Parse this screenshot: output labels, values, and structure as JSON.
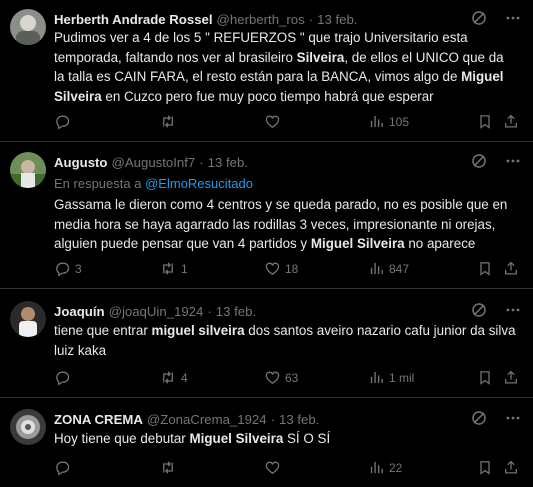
{
  "colors": {
    "background": "#000000",
    "text_primary": "#e7e9ea",
    "text_secondary": "#71767b",
    "link": "#1d9bf0",
    "divider": "#2f3336"
  },
  "icons": {
    "reply": "reply-icon",
    "repost": "repost-icon",
    "like": "heart-icon",
    "views": "views-icon",
    "bookmark": "bookmark-icon",
    "share": "share-icon",
    "grok": "grok-icon",
    "more": "more-icon"
  },
  "tweets": [
    {
      "name": "Herberth Andrade Rossel",
      "handle": "@herberth_ros",
      "date": "13 feb.",
      "reply_to_prefix": "",
      "reply_to_handle": "",
      "body": [
        {
          "t": "Pudimos ver a 4 de los 5 \" REFUERZOS \" que trajo Universitario esta temporada, faltando nos ver al brasileiro "
        },
        {
          "t": "Silveira",
          "b": true
        },
        {
          "t": ", de ellos el UNICO que da la talla es CAIN FARA, el resto están para la BANCA, vimos algo de "
        },
        {
          "t": "Miguel Silveira",
          "b": true
        },
        {
          "t": " en Cuzco pero fue muy poco tiempo habrá que esperar"
        }
      ],
      "replies": "",
      "reposts": "",
      "likes": "",
      "views": "105"
    },
    {
      "name": "Augusto",
      "handle": "@AugustoInf7",
      "date": "13 feb.",
      "reply_to_prefix": "En respuesta a",
      "reply_to_handle": "@ElmoResucitado",
      "body": [
        {
          "t": "Gassama le dieron como 4 centros y se queda parado, no es posible que en media hora se haya agarrado las rodillas 3 veces, impresionante ni orejas, alguien puede pensar que van 4 partidos y "
        },
        {
          "t": "Miguel Silveira",
          "b": true
        },
        {
          "t": " no aparece"
        }
      ],
      "replies": "3",
      "reposts": "1",
      "likes": "18",
      "views": "847"
    },
    {
      "name": "Joaquín",
      "handle": "@joaqUin_1924",
      "date": "13 feb.",
      "reply_to_prefix": "",
      "reply_to_handle": "",
      "body": [
        {
          "t": "tiene que entrar "
        },
        {
          "t": "miguel silveira",
          "b": true
        },
        {
          "t": " dos santos aveiro nazario cafu junior da silva luiz kaka"
        }
      ],
      "replies": "",
      "reposts": "4",
      "likes": "63",
      "views": "1 mil"
    },
    {
      "name": "ZONA CREMA",
      "handle": "@ZonaCrema_1924",
      "date": "13 feb.",
      "reply_to_prefix": "",
      "reply_to_handle": "",
      "body": [
        {
          "t": "Hoy tiene que debutar "
        },
        {
          "t": "Miguel Silveira",
          "b": true
        },
        {
          "t": " SÍ O SÍ"
        }
      ],
      "replies": "",
      "reposts": "",
      "likes": "",
      "views": "22"
    }
  ]
}
